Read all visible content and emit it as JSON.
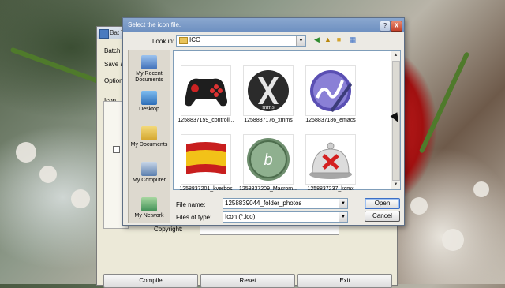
{
  "background_window": {
    "title": "Bat T",
    "batch_label": "Batch fi",
    "save_label": "Save as",
    "options_tab": "Options",
    "icon_label": "Icon",
    "copyright_label": "Copyright:",
    "buttons": {
      "compile": "Compile",
      "reset": "Reset",
      "exit": "Exit"
    }
  },
  "dialog": {
    "title": "Select the icon file.",
    "help_label": "?",
    "close_label": "X",
    "look_in_label": "Look in:",
    "look_in_value": "ICO",
    "places": [
      {
        "label": "My Recent Documents",
        "icon": "recent-documents-icon"
      },
      {
        "label": "Desktop",
        "icon": "desktop-icon"
      },
      {
        "label": "My Documents",
        "icon": "my-documents-icon"
      },
      {
        "label": "My Computer",
        "icon": "my-computer-icon"
      },
      {
        "label": "My Network",
        "icon": "my-network-icon"
      }
    ],
    "files": [
      {
        "name": "1258837159_controll...",
        "icon": "gamepad-icon"
      },
      {
        "name": "1258837176_xmms",
        "icon": "xmms-icon"
      },
      {
        "name": "1258837186_emacs",
        "icon": "emacs-icon"
      },
      {
        "name": "1258837201_kverbos",
        "icon": "spain-flag-icon"
      },
      {
        "name": "1258837209_Macrom...",
        "icon": "macromedia-icon"
      },
      {
        "name": "1258837237_kcmx",
        "icon": "cloche-icon"
      }
    ],
    "file_name_label": "File name:",
    "file_name_value": "1258839044_folder_photos",
    "files_of_type_label": "Files of type:",
    "files_of_type_value": "Icon (*.ico)",
    "open_label": "Open",
    "cancel_label": "Cancel"
  },
  "colors": {
    "accent_blue": "#6d8fc0",
    "close_red": "#c3412a",
    "rose_red": "#c81e1e"
  }
}
